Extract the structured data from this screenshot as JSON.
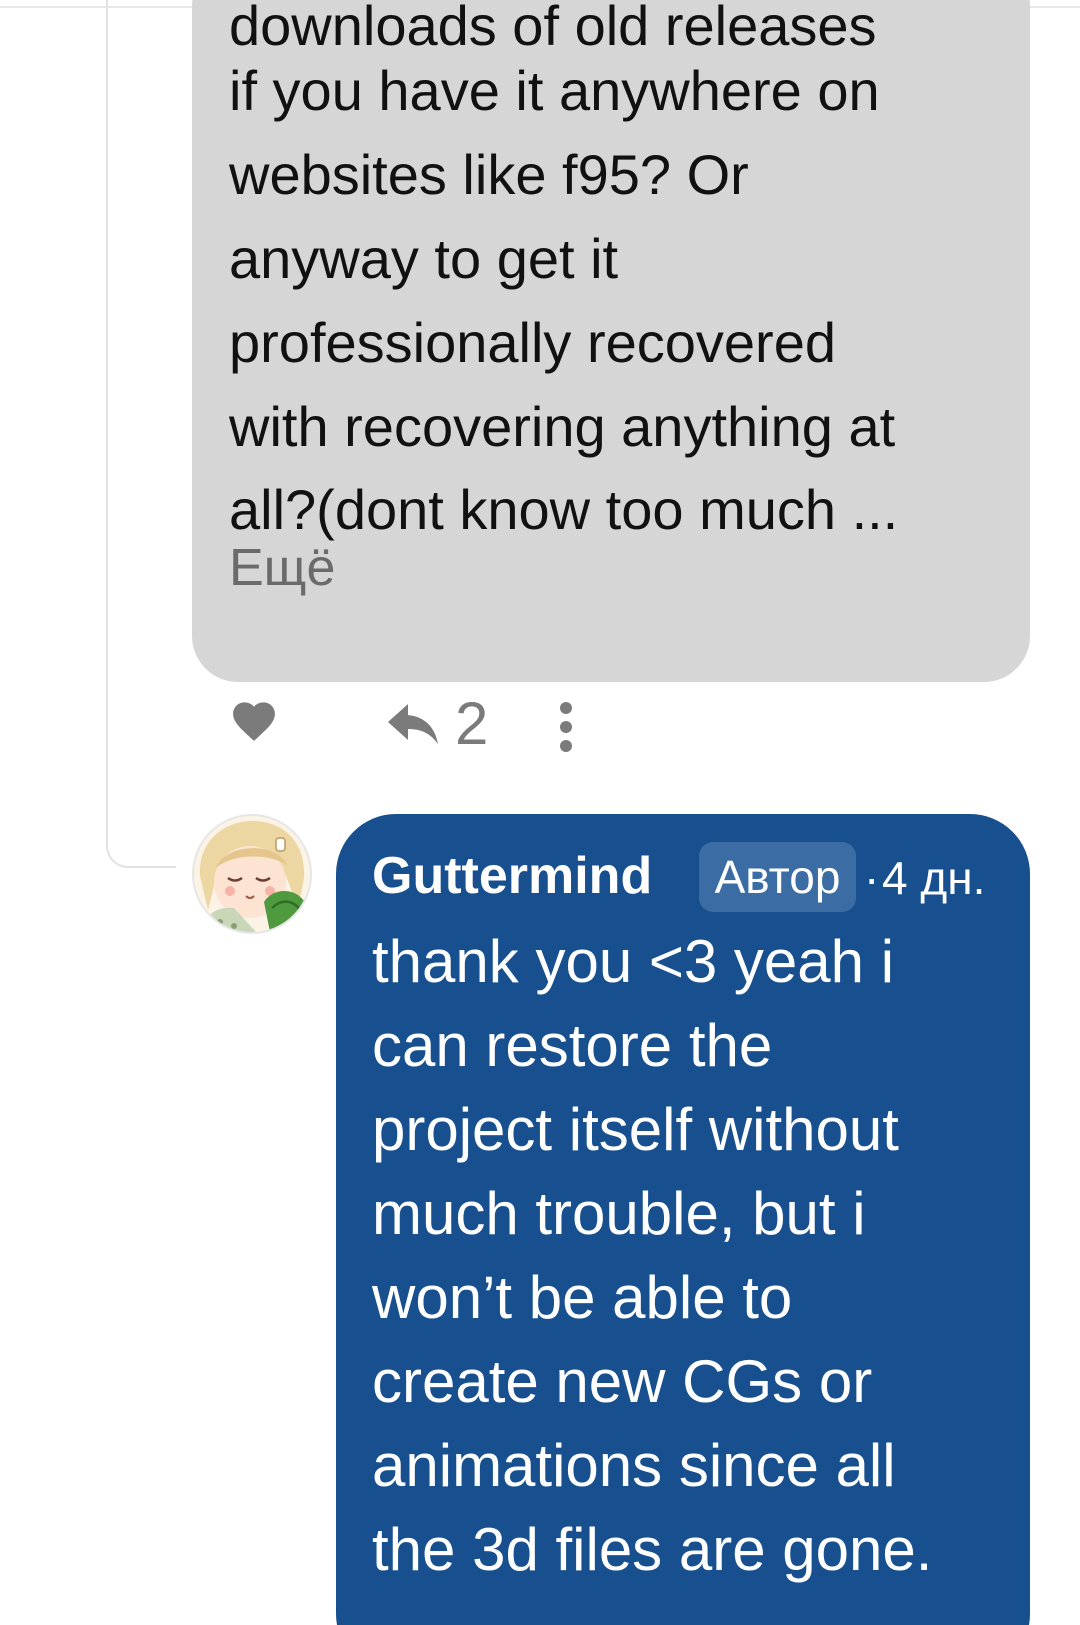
{
  "parent_comment": {
    "clipped_line": "downloads of old releases",
    "lines": [
      "if you have it anywhere on",
      "websites like f95?  Or",
      "anyway to get it",
      "professionally recovered",
      "with recovering anything at",
      "all?(dont know too much ..."
    ],
    "more_label": "Ещё",
    "reply_count": "2",
    "icons": {
      "like": "heart-icon",
      "reply": "reply-arrow-icon",
      "more": "more-vertical-icon"
    }
  },
  "reply_comment": {
    "author_name": "Guttermind",
    "author_badge": "Автор",
    "separator": "·",
    "time_ago": "4 дн.",
    "lines": [
      "thank you <3 yeah i",
      "can restore the",
      "project itself without",
      "much trouble, but i",
      "won’t be able to",
      "create new CGs or",
      "animations since all",
      "the 3d files are gone."
    ]
  },
  "colors": {
    "gray_bubble": "#d6d6d6",
    "blue_bubble": "#18508f",
    "badge": "#3b6ca4",
    "icon_gray": "#7b7b7b"
  }
}
